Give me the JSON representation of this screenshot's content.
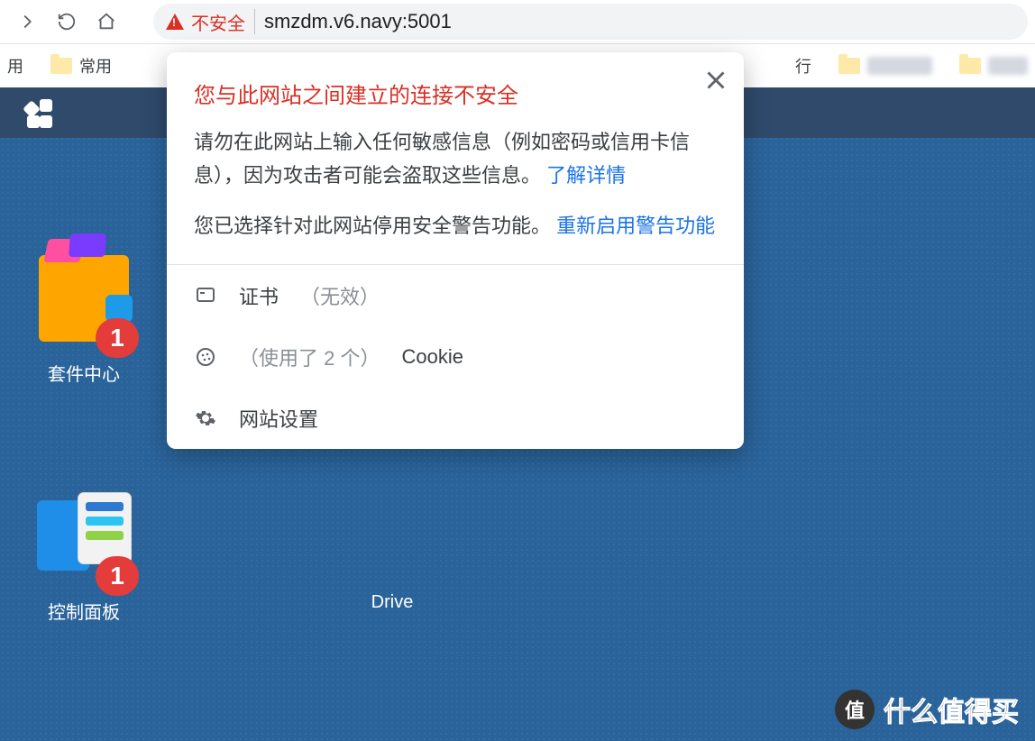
{
  "chrome": {
    "insecure_label": "不安全",
    "url": "smzdm.v6.navy:5001"
  },
  "bookmarks": {
    "b1": "用",
    "b2": "常用",
    "b3": "行"
  },
  "popover": {
    "title": "您与此网站之间建立的连接不安全",
    "body1": "请勿在此网站上输入任何敏感信息（例如密码或信用卡信息），因为攻击者可能会盗取这些信息。",
    "learn_more": "了解详情",
    "body2": "您已选择针对此网站停用安全警告功能。",
    "reenable": "重新启用警告功能",
    "cert_label": "证书",
    "cert_status": "（无效）",
    "cookie_count": "（使用了 2 个）",
    "cookie_label": "Cookie",
    "site_settings": "网站设置"
  },
  "desktop": {
    "package_center": {
      "label": "套件中心",
      "badge": "1"
    },
    "control_panel": {
      "label": "控制面板",
      "badge": "1"
    },
    "drive": {
      "label": "Drive"
    }
  },
  "watermark": {
    "circle": "值",
    "text": "什么值得买"
  }
}
